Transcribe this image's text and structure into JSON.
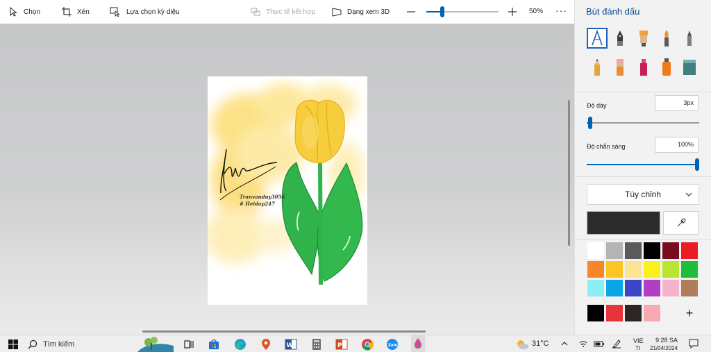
{
  "toolbar": {
    "select_label": "Chọn",
    "crop_label": "Xén",
    "magic_select_label": "Lựa chọn kỳ diệu",
    "mixed_reality_label": "Thực tế kết hợp",
    "view3d_label": "Dạng xem 3D",
    "zoom_value": "50%",
    "zoom_level": 0.22,
    "more_label": "···"
  },
  "canvas": {
    "signature_line1": "Tranvanduy3056",
    "signature_line2": "# Heidap247"
  },
  "panel": {
    "title": "Bút đánh dấu",
    "tools": [
      "calligraphy-pen",
      "ink-pen",
      "marker",
      "oil-brush",
      "pencil",
      "pencil",
      "crayon",
      "highlighter",
      "spray-can",
      "paint-bucket"
    ],
    "thickness_label": "Độ dày",
    "thickness_value": "3px",
    "thickness_level": 0.03,
    "opacity_label": "Độ chắn sáng",
    "opacity_value": "100%",
    "opacity_level": 1.0,
    "texture_label": "Tùy chỉnh",
    "current_color": "#2b2b2b",
    "palette": [
      "#ffffff",
      "#b4b4b4",
      "#5a5a5a",
      "#000000",
      "#7a0b1f",
      "#ea1c24",
      "#f7852a",
      "#fec421",
      "#fbe493",
      "#f9f21a",
      "#b8e432",
      "#1fbe3a",
      "#8aeef4",
      "#0aa7e8",
      "#3d46c8",
      "#b03fc3",
      "#f6b3c9",
      "#b07c5a"
    ],
    "custom_colors": [
      "#000000",
      "#e7343a",
      "#2d2424",
      "#f6aab2"
    ],
    "add_color_label": "+"
  },
  "taskbar": {
    "search_label": "Tìm kiếm",
    "weather_temp": "31°C",
    "language_line1": "VIE",
    "language_line2": "TI",
    "time": "9:28 SA",
    "date": "21/04/2024"
  }
}
